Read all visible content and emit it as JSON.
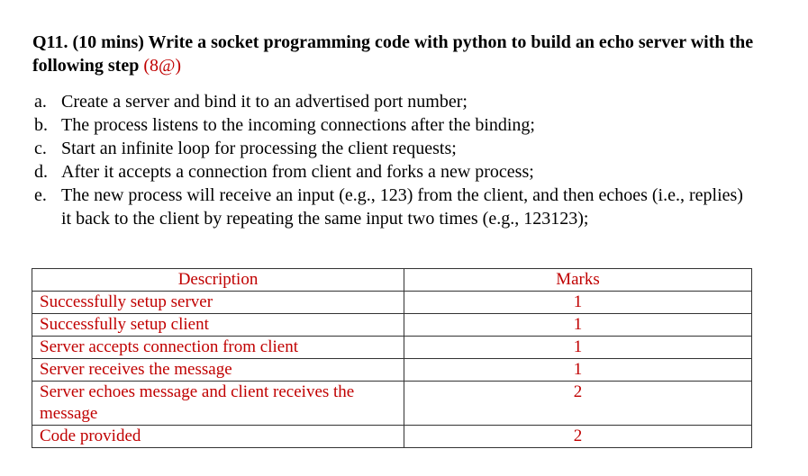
{
  "question": {
    "title": "Q11. (10 mins) Write a socket programming code with python to build an echo server with the following step",
    "marks": "(8@)"
  },
  "steps": [
    {
      "letter": "a.",
      "text": "Create a server and bind it to an advertised port number;"
    },
    {
      "letter": "b.",
      "text": "The process listens to the incoming connections after the binding;"
    },
    {
      "letter": "c.",
      "text": "Start an infinite loop for processing the client requests;"
    },
    {
      "letter": "d.",
      "text": "After it accepts a connection from client and forks a new process;"
    },
    {
      "letter": "e.",
      "text": "The new process will receive an input (e.g., 123) from the client, and then echoes (i.e., replies) it back to the client by repeating the same input two times (e.g., 123123);"
    }
  ],
  "rubric": {
    "headers": {
      "description": "Description",
      "marks": "Marks"
    },
    "rows": [
      {
        "description": "Successfully setup server",
        "marks": "1"
      },
      {
        "description": "Successfully setup client",
        "marks": "1"
      },
      {
        "description": "Server accepts connection from client",
        "marks": "1"
      },
      {
        "description": "Server receives the message",
        "marks": "1"
      },
      {
        "description": "Server echoes message and client receives the message",
        "marks": "2"
      },
      {
        "description": "Code provided",
        "marks": "2"
      }
    ]
  },
  "colors": {
    "accent_red": "#c00000",
    "text": "#000000"
  }
}
